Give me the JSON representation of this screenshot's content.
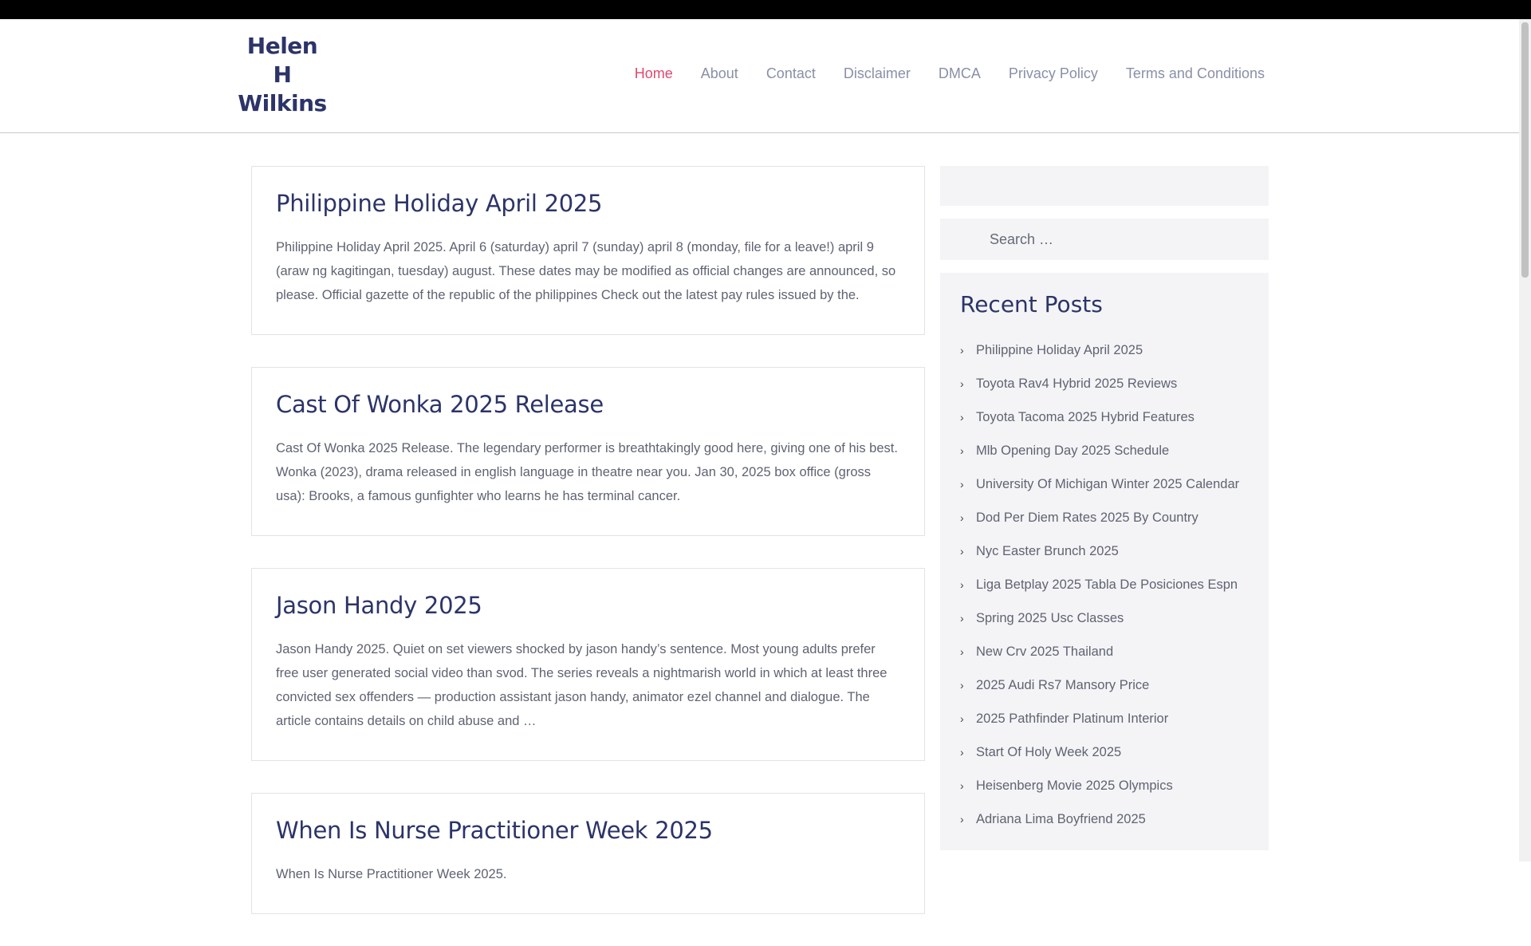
{
  "site": {
    "title_lines": [
      "Helen",
      "H",
      "Wilkins"
    ]
  },
  "nav": [
    {
      "label": "Home",
      "active": true
    },
    {
      "label": "About"
    },
    {
      "label": "Contact"
    },
    {
      "label": "Disclaimer"
    },
    {
      "label": "DMCA"
    },
    {
      "label": "Privacy Policy"
    },
    {
      "label": "Terms and Conditions"
    }
  ],
  "posts": [
    {
      "title": "Philippine Holiday April 2025",
      "excerpt": "Philippine Holiday April 2025. April 6 (saturday) april 7 (sunday) april 8 (monday, file for a leave!) april 9 (araw ng kagitingan, tuesday) august. These dates may be modified as official changes are announced, so please. Official gazette of the republic of the philippines Check out the latest pay rules issued by the."
    },
    {
      "title": "Cast Of Wonka 2025 Release",
      "excerpt": "Cast Of Wonka 2025 Release. The legendary performer is breathtakingly good here, giving one of his best. Wonka (2023), drama released in english language in theatre near you. Jan 30, 2025 box office (gross usa): Brooks, a famous gunfighter who learns he has terminal cancer."
    },
    {
      "title": "Jason Handy 2025",
      "excerpt": "Jason Handy 2025. Quiet on set viewers shocked by jason handy’s sentence. Most young adults prefer free user generated social video than svod. The series reveals a nightmarish world in which at least three convicted sex offenders — production assistant jason handy, animator ezel channel and dialogue. The article contains details on child abuse and …"
    },
    {
      "title": "When Is Nurse Practitioner Week 2025",
      "excerpt": "When Is Nurse Practitioner Week 2025."
    }
  ],
  "sidebar": {
    "search_placeholder": "Search …",
    "recent_title": "Recent Posts",
    "recent_posts": [
      "Philippine Holiday April 2025",
      "Toyota Rav4 Hybrid 2025 Reviews",
      "Toyota Tacoma 2025 Hybrid Features",
      "Mlb Opening Day 2025 Schedule",
      "University Of Michigan Winter 2025 Calendar",
      "Dod Per Diem Rates 2025 By Country",
      "Nyc Easter Brunch 2025",
      "Liga Betplay 2025 Tabla De Posiciones Espn",
      "Spring 2025 Usc Classes",
      "New Crv 2025 Thailand",
      "2025 Audi Rs7 Mansory Price",
      "2025 Pathfinder Platinum Interior",
      "Start Of Holy Week 2025",
      "Heisenberg Movie 2025 Olympics",
      "Adriana Lima Boyfriend 2025"
    ]
  },
  "colors": {
    "accent": "#e0486f",
    "heading": "#2c3468",
    "body_text": "#5f6372",
    "nav_text": "#8a8fa8"
  }
}
